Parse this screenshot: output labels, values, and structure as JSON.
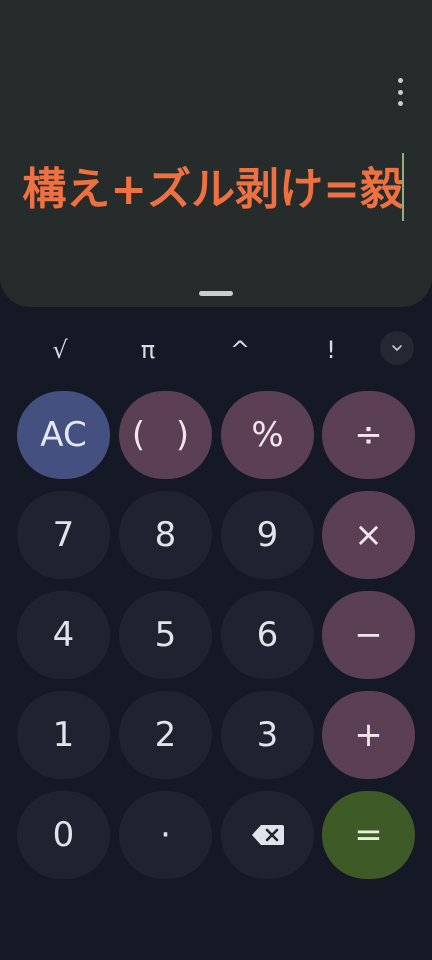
{
  "display": {
    "expression": "構え+ズル剥け=毅"
  },
  "icons": {
    "menu": "more-vert-icon",
    "expand": "chevron-down-icon",
    "backspace": "backspace-icon"
  },
  "scientific": {
    "sqrt": "√",
    "pi": "π",
    "power": "^",
    "factorial": "!"
  },
  "keys": {
    "ac": "AC",
    "parens": "( )",
    "percent": "%",
    "divide": "÷",
    "seven": "7",
    "eight": "8",
    "nine": "9",
    "multiply": "×",
    "four": "4",
    "five": "5",
    "six": "6",
    "minus": "−",
    "one": "1",
    "two": "2",
    "three": "3",
    "plus": "+",
    "zero": "0",
    "decimal": "·",
    "equals": "="
  },
  "colors": {
    "expression": "#ef7040",
    "display_bg": "#262b2b",
    "keypad_bg": "#151926",
    "ac_key": "#445080",
    "operator_key": "#5b3f55",
    "equals_key": "#3e5a26",
    "number_key": "#1f2330"
  }
}
